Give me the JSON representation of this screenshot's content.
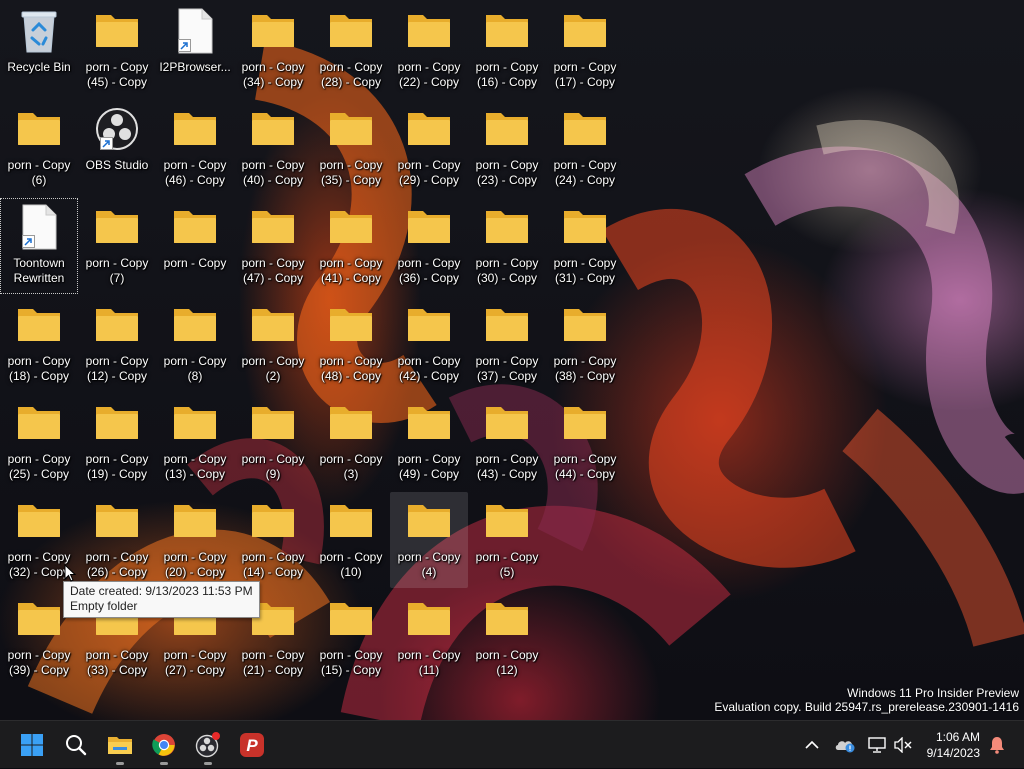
{
  "desktop": {
    "icons": [
      {
        "label": "Recycle Bin",
        "type": "recycle-bin"
      },
      {
        "label": "porn - Copy (6)",
        "type": "folder"
      },
      {
        "label": "Toontown Rewritten",
        "type": "file-shortcut",
        "selected": true
      },
      {
        "label": "porn - Copy (18) - Copy",
        "type": "folder"
      },
      {
        "label": "porn - Copy (25) - Copy",
        "type": "folder"
      },
      {
        "label": "porn - Copy (32) - Copy",
        "type": "folder"
      },
      {
        "label": "porn - Copy (39) - Copy",
        "type": "folder"
      },
      {
        "label": "porn - Copy (45) - Copy",
        "type": "folder"
      },
      {
        "label": "OBS Studio",
        "type": "obs-shortcut"
      },
      {
        "label": "porn - Copy (7)",
        "type": "folder"
      },
      {
        "label": "porn - Copy (12) - Copy",
        "type": "folder"
      },
      {
        "label": "porn - Copy (19) - Copy",
        "type": "folder"
      },
      {
        "label": "porn - Copy (26) - Copy",
        "type": "folder"
      },
      {
        "label": "porn - Copy (33) - Copy",
        "type": "folder"
      },
      {
        "label": "I2PBrowser...",
        "type": "file-shortcut"
      },
      {
        "label": "porn - Copy (46) - Copy",
        "type": "folder"
      },
      {
        "label": "porn - Copy",
        "type": "folder"
      },
      {
        "label": "porn - Copy (8)",
        "type": "folder"
      },
      {
        "label": "porn - Copy (13) - Copy",
        "type": "folder"
      },
      {
        "label": "porn - Copy (20) - Copy",
        "type": "folder"
      },
      {
        "label": "porn - Copy (27) - Copy",
        "type": "folder"
      },
      {
        "label": "porn - Copy (34) - Copy",
        "type": "folder"
      },
      {
        "label": "porn - Copy (40) - Copy",
        "type": "folder"
      },
      {
        "label": "porn - Copy (47) - Copy",
        "type": "folder"
      },
      {
        "label": "porn - Copy (2)",
        "type": "folder"
      },
      {
        "label": "porn - Copy (9)",
        "type": "folder"
      },
      {
        "label": "porn - Copy (14) - Copy",
        "type": "folder"
      },
      {
        "label": "porn - Copy (21) - Copy",
        "type": "folder"
      },
      {
        "label": "porn - Copy (28) - Copy",
        "type": "folder"
      },
      {
        "label": "porn - Copy (35) - Copy",
        "type": "folder"
      },
      {
        "label": "porn - Copy (41) - Copy",
        "type": "folder"
      },
      {
        "label": "porn - Copy (48) - Copy",
        "type": "folder"
      },
      {
        "label": "porn - Copy (3)",
        "type": "folder"
      },
      {
        "label": "porn - Copy (10)",
        "type": "folder"
      },
      {
        "label": "porn - Copy (15) - Copy",
        "type": "folder"
      },
      {
        "label": "porn - Copy (22) - Copy",
        "type": "folder"
      },
      {
        "label": "porn - Copy (29) - Copy",
        "type": "folder"
      },
      {
        "label": "porn - Copy (36) - Copy",
        "type": "folder"
      },
      {
        "label": "porn - Copy (42) - Copy",
        "type": "folder"
      },
      {
        "label": "porn - Copy (49) - Copy",
        "type": "folder"
      },
      {
        "label": "porn - Copy (4)",
        "type": "folder",
        "hover": true
      },
      {
        "label": "porn - Copy (11)",
        "type": "folder"
      },
      {
        "label": "porn - Copy (16) - Copy",
        "type": "folder"
      },
      {
        "label": "porn - Copy (23) - Copy",
        "type": "folder"
      },
      {
        "label": "porn - Copy (30) - Copy",
        "type": "folder"
      },
      {
        "label": "porn - Copy (37) - Copy",
        "type": "folder"
      },
      {
        "label": "porn - Copy (43) - Copy",
        "type": "folder"
      },
      {
        "label": "porn - Copy (5)",
        "type": "folder"
      },
      {
        "label": "porn - Copy (12)",
        "type": "folder"
      },
      {
        "label": "porn - Copy (17) - Copy",
        "type": "folder"
      },
      {
        "label": "porn - Copy (24) - Copy",
        "type": "folder"
      },
      {
        "label": "porn - Copy (31) - Copy",
        "type": "folder"
      },
      {
        "label": "porn - Copy (38) - Copy",
        "type": "folder"
      },
      {
        "label": "porn - Copy (44) - Copy",
        "type": "folder"
      }
    ]
  },
  "tooltip": {
    "line1": "Date created: 9/13/2023 11:53 PM",
    "line2": "Empty folder"
  },
  "watermark": {
    "line1": "Windows 11 Pro Insider Preview",
    "line2": "Evaluation copy. Build 25947.rs_prerelease.230901-1416"
  },
  "taskbar": {
    "apps": [
      {
        "name": "start-icon",
        "open": false
      },
      {
        "name": "search-icon",
        "open": false
      },
      {
        "name": "file-explorer-icon",
        "open": true
      },
      {
        "name": "chrome-icon",
        "open": true
      },
      {
        "name": "obs-studio-icon",
        "open": true
      },
      {
        "name": "proton-vpn-icon",
        "open": false
      }
    ],
    "tray": [
      "chevron-up-icon",
      "onedrive-icon",
      "network-icon",
      "speaker-muted-icon",
      "notification-bell-icon"
    ],
    "clock": {
      "time": "1:06 AM",
      "date": "9/14/2023"
    }
  },
  "colors": {
    "folder": "#f5c64c",
    "folder_back": "#e8ad2c",
    "taskbar": "#1c1c1e",
    "notification": "#f38a7a"
  }
}
